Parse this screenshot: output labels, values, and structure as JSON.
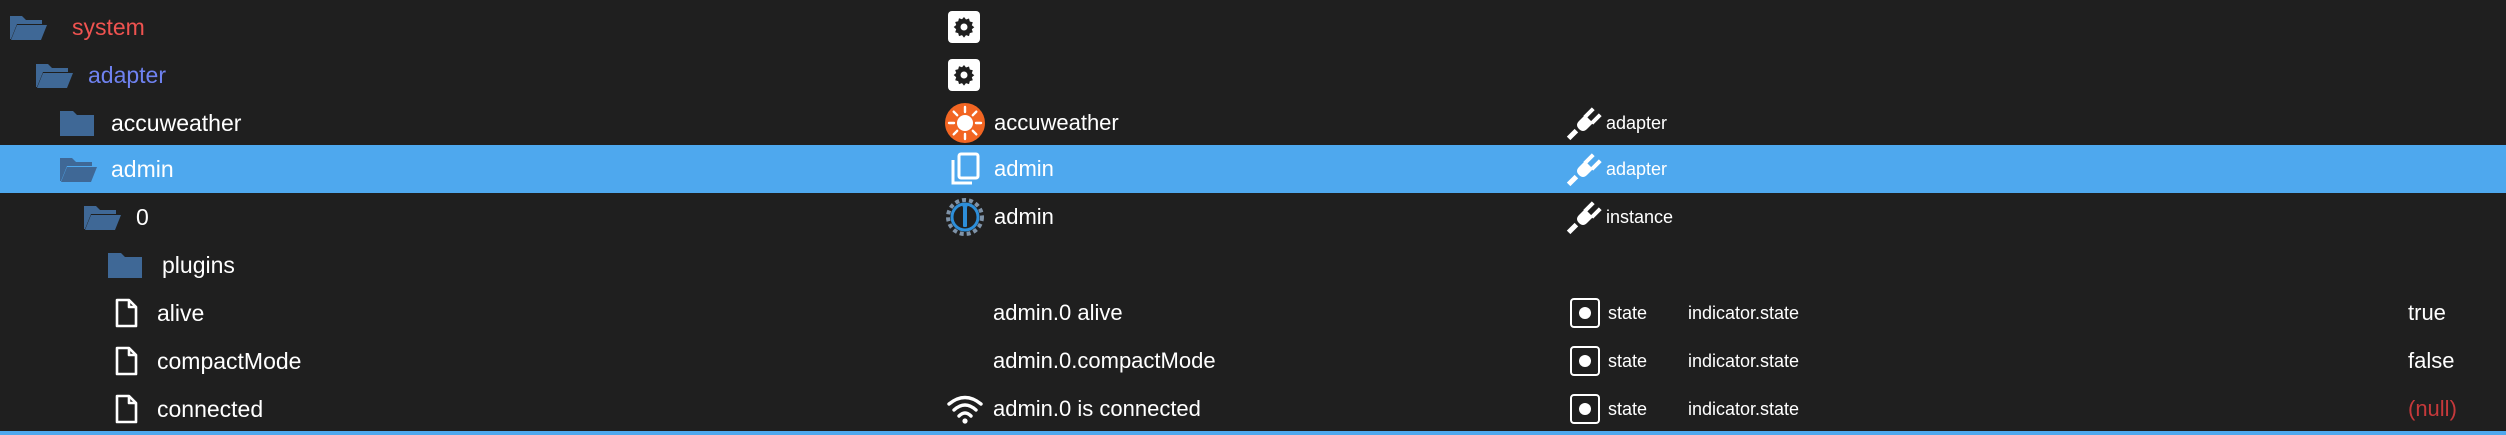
{
  "colors": {
    "background": "#1f1f1f",
    "selected_row": "#4ea8ee",
    "folder": "#3f6896",
    "system_text": "#ef5350",
    "adapter_text": "#6f82f0",
    "null_text": "#c6393b",
    "accuweather_icon": "#f26522"
  },
  "rows": [
    {
      "name": "system",
      "name_icon": "folder-open-icon",
      "obj_icon": "gear-icon"
    },
    {
      "name": "adapter",
      "name_icon": "folder-open-icon",
      "obj_icon": "gear-icon"
    },
    {
      "name": "accuweather",
      "name_icon": "folder-icon",
      "obj_icon": "accuweather-logo-icon",
      "col_name": "accuweather",
      "type_icon": "plug-icon",
      "type": "adapter"
    },
    {
      "name": "admin",
      "name_icon": "folder-open-icon",
      "obj_icon": "copy-icon",
      "col_name": "admin",
      "type_icon": "plug-icon",
      "type": "adapter",
      "selected": true
    },
    {
      "name": "0",
      "name_icon": "folder-open-icon",
      "obj_icon": "admin-logo-icon",
      "col_name": "admin",
      "type_icon": "plug-icon",
      "type": "instance"
    },
    {
      "name": "plugins",
      "name_icon": "folder-icon"
    },
    {
      "name": "alive",
      "name_icon": "file-icon",
      "col_name": "admin.0 alive",
      "type_icon": "state-icon",
      "type": "state",
      "role": "indicator.state",
      "value": "true"
    },
    {
      "name": "compactMode",
      "name_icon": "file-icon",
      "col_name": "admin.0.compactMode",
      "type_icon": "state-icon",
      "type": "state",
      "role": "indicator.state",
      "value": "false"
    },
    {
      "name": "connected",
      "name_icon": "file-icon",
      "obj_icon": "wifi-icon",
      "col_name": "admin.0 is connected",
      "type_icon": "state-icon",
      "type": "state",
      "role": "indicator.state",
      "value": "(null)"
    }
  ]
}
